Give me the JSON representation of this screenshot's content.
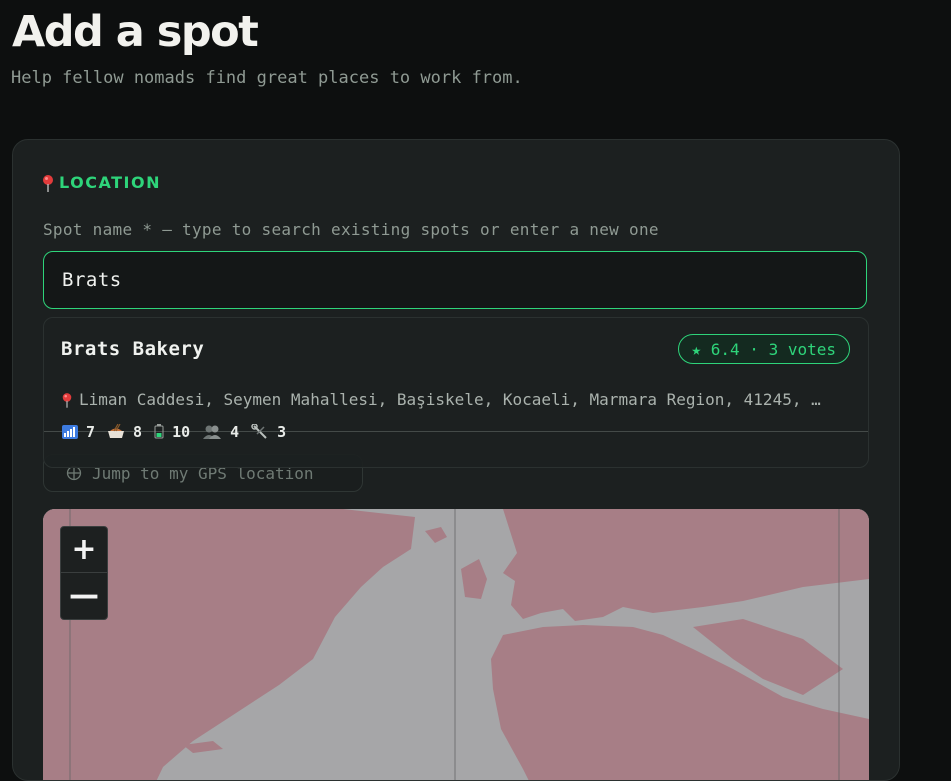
{
  "header": {
    "title": "Add a spot",
    "subtitle": "Help fellow nomads find great places to work from."
  },
  "location_section": {
    "title": "LOCATION",
    "icon": "pin-icon",
    "spot_name_label": "Spot name * — type to search existing spots or enter a new one",
    "spot_name_value": "Brats",
    "gps_button_label": "Jump to my GPS location",
    "map_zoom_in": "+",
    "map_zoom_out": "—"
  },
  "search_results": [
    {
      "name": "Brats Bakery",
      "rating": "★ 6.4 · 3 votes",
      "address": "Liman Caddesi, Seymen Mahallesi, Başiskele, Kocaeli, Marmara Region, 41245, …",
      "stats": [
        {
          "icon": "wifi-icon",
          "value": "7"
        },
        {
          "icon": "food-icon",
          "value": "8"
        },
        {
          "icon": "power-icon",
          "value": "10"
        },
        {
          "icon": "crowd-icon",
          "value": "4"
        },
        {
          "icon": "tools-icon",
          "value": "3"
        }
      ]
    }
  ],
  "colors": {
    "accent": "#2ed47a",
    "background": "#0d0f0f",
    "card": "#1c2020",
    "map_land": "#a77e86",
    "map_water": "#a6a6a8"
  }
}
